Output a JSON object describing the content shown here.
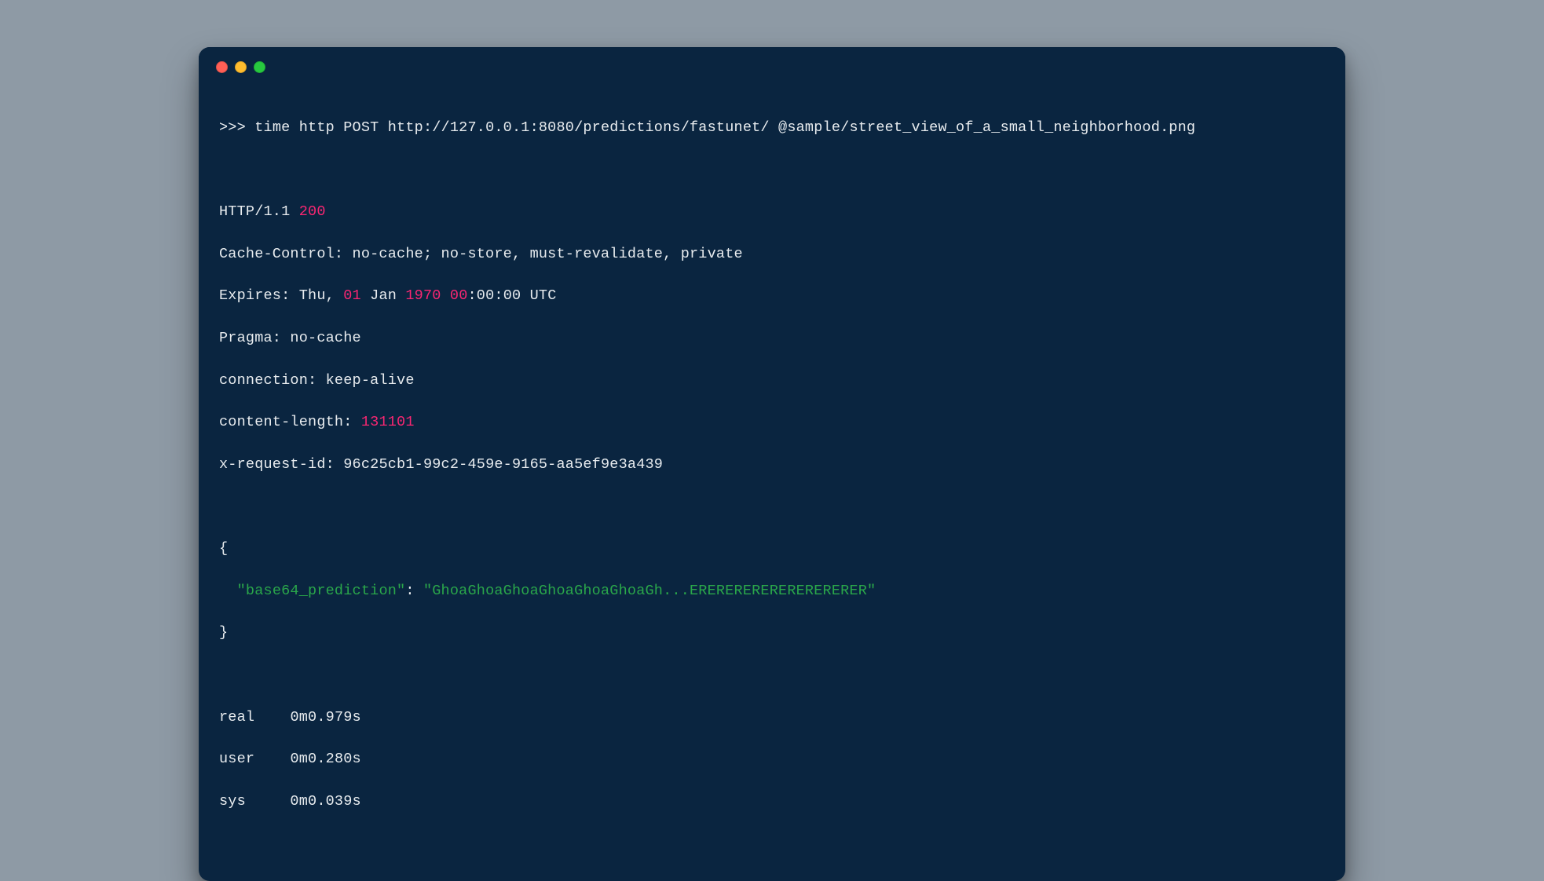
{
  "prompt": ">>> ",
  "command": "time http POST http://127.0.0.1:8080/predictions/fastunet/ @sample/street_view_of_a_small_neighborhood.png",
  "response": {
    "protocol": "HTTP/1.1 ",
    "status": "200",
    "headers": {
      "cache_control_k": "Cache-Control: ",
      "cache_control_v": "no-cache; no-store, must-revalidate, private",
      "expires_k": "Expires: ",
      "expires_v_pre": "Thu, ",
      "expires_day": "01",
      "expires_mid": " Jan ",
      "expires_year": "1970",
      "expires_sp1": " ",
      "expires_hour": "00",
      "expires_rest": ":00:00 UTC",
      "pragma_k": "Pragma: ",
      "pragma_v": "no-cache",
      "connection_k": "connection: ",
      "connection_v": "keep-alive",
      "content_length_k": "content-length: ",
      "content_length_v": "131101",
      "xreq_k": "x-request-id: ",
      "xreq_v": "96c25cb1-99c2-459e-9165-aa5ef9e3a439"
    },
    "body": {
      "open": "{",
      "indent": "  ",
      "key": "\"base64_prediction\"",
      "sep": ": ",
      "value": "\"GhoaGhoaGhoaGhoaGhoaGhoaGh...ERERERERERERERERERER\"",
      "close": "}"
    }
  },
  "timing": {
    "real_k": "real",
    "real_v": "0m0.979s",
    "user_k": "user",
    "user_v": "0m0.280s",
    "sys_k": "sys",
    "sys_v": "0m0.039s",
    "gap_real": "    ",
    "gap_user": "    ",
    "gap_sys": "     "
  }
}
